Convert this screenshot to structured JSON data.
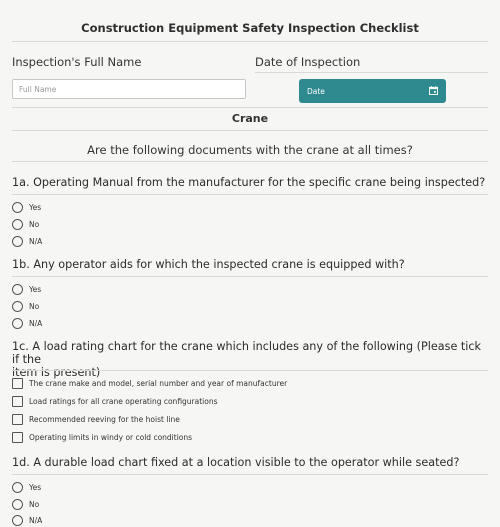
{
  "form": {
    "title": "Construction Equipment Safety Inspection Checklist",
    "name_label": "Inspection's Full Name",
    "name_placeholder": "Full Name",
    "date_label": "Date of Inspection",
    "date_value": "Date",
    "accent_color": "#2e8a8f"
  },
  "section": {
    "title": "Crane",
    "question": "Are the following documents with the crane at all times?"
  },
  "questions": [
    {
      "text": "1a. Operating Manual from the manufacturer for the specific crane being inspected?",
      "type": "radio",
      "options": [
        "Yes",
        "No",
        "N/A"
      ]
    },
    {
      "text": "1b. Any operator aids for which the inspected crane is equipped with?",
      "type": "radio",
      "options": [
        "Yes",
        "No",
        "N/A"
      ]
    },
    {
      "text_line1": "1c. A load rating chart for the crane which includes any of the following (Please tick if the",
      "text_line2": "item is present)",
      "type": "checkbox",
      "options": [
        "The crane make and model, serial number and year of manufacturer",
        "Load ratings for all crane operating configurations",
        "Recommended reeving for the hoist line",
        "Operating limits in windy or cold conditions"
      ]
    },
    {
      "text": "1d. A durable load chart fixed at a location visible to the operator while seated?",
      "type": "radio",
      "options": [
        "Yes",
        "No",
        "N/A"
      ]
    }
  ]
}
